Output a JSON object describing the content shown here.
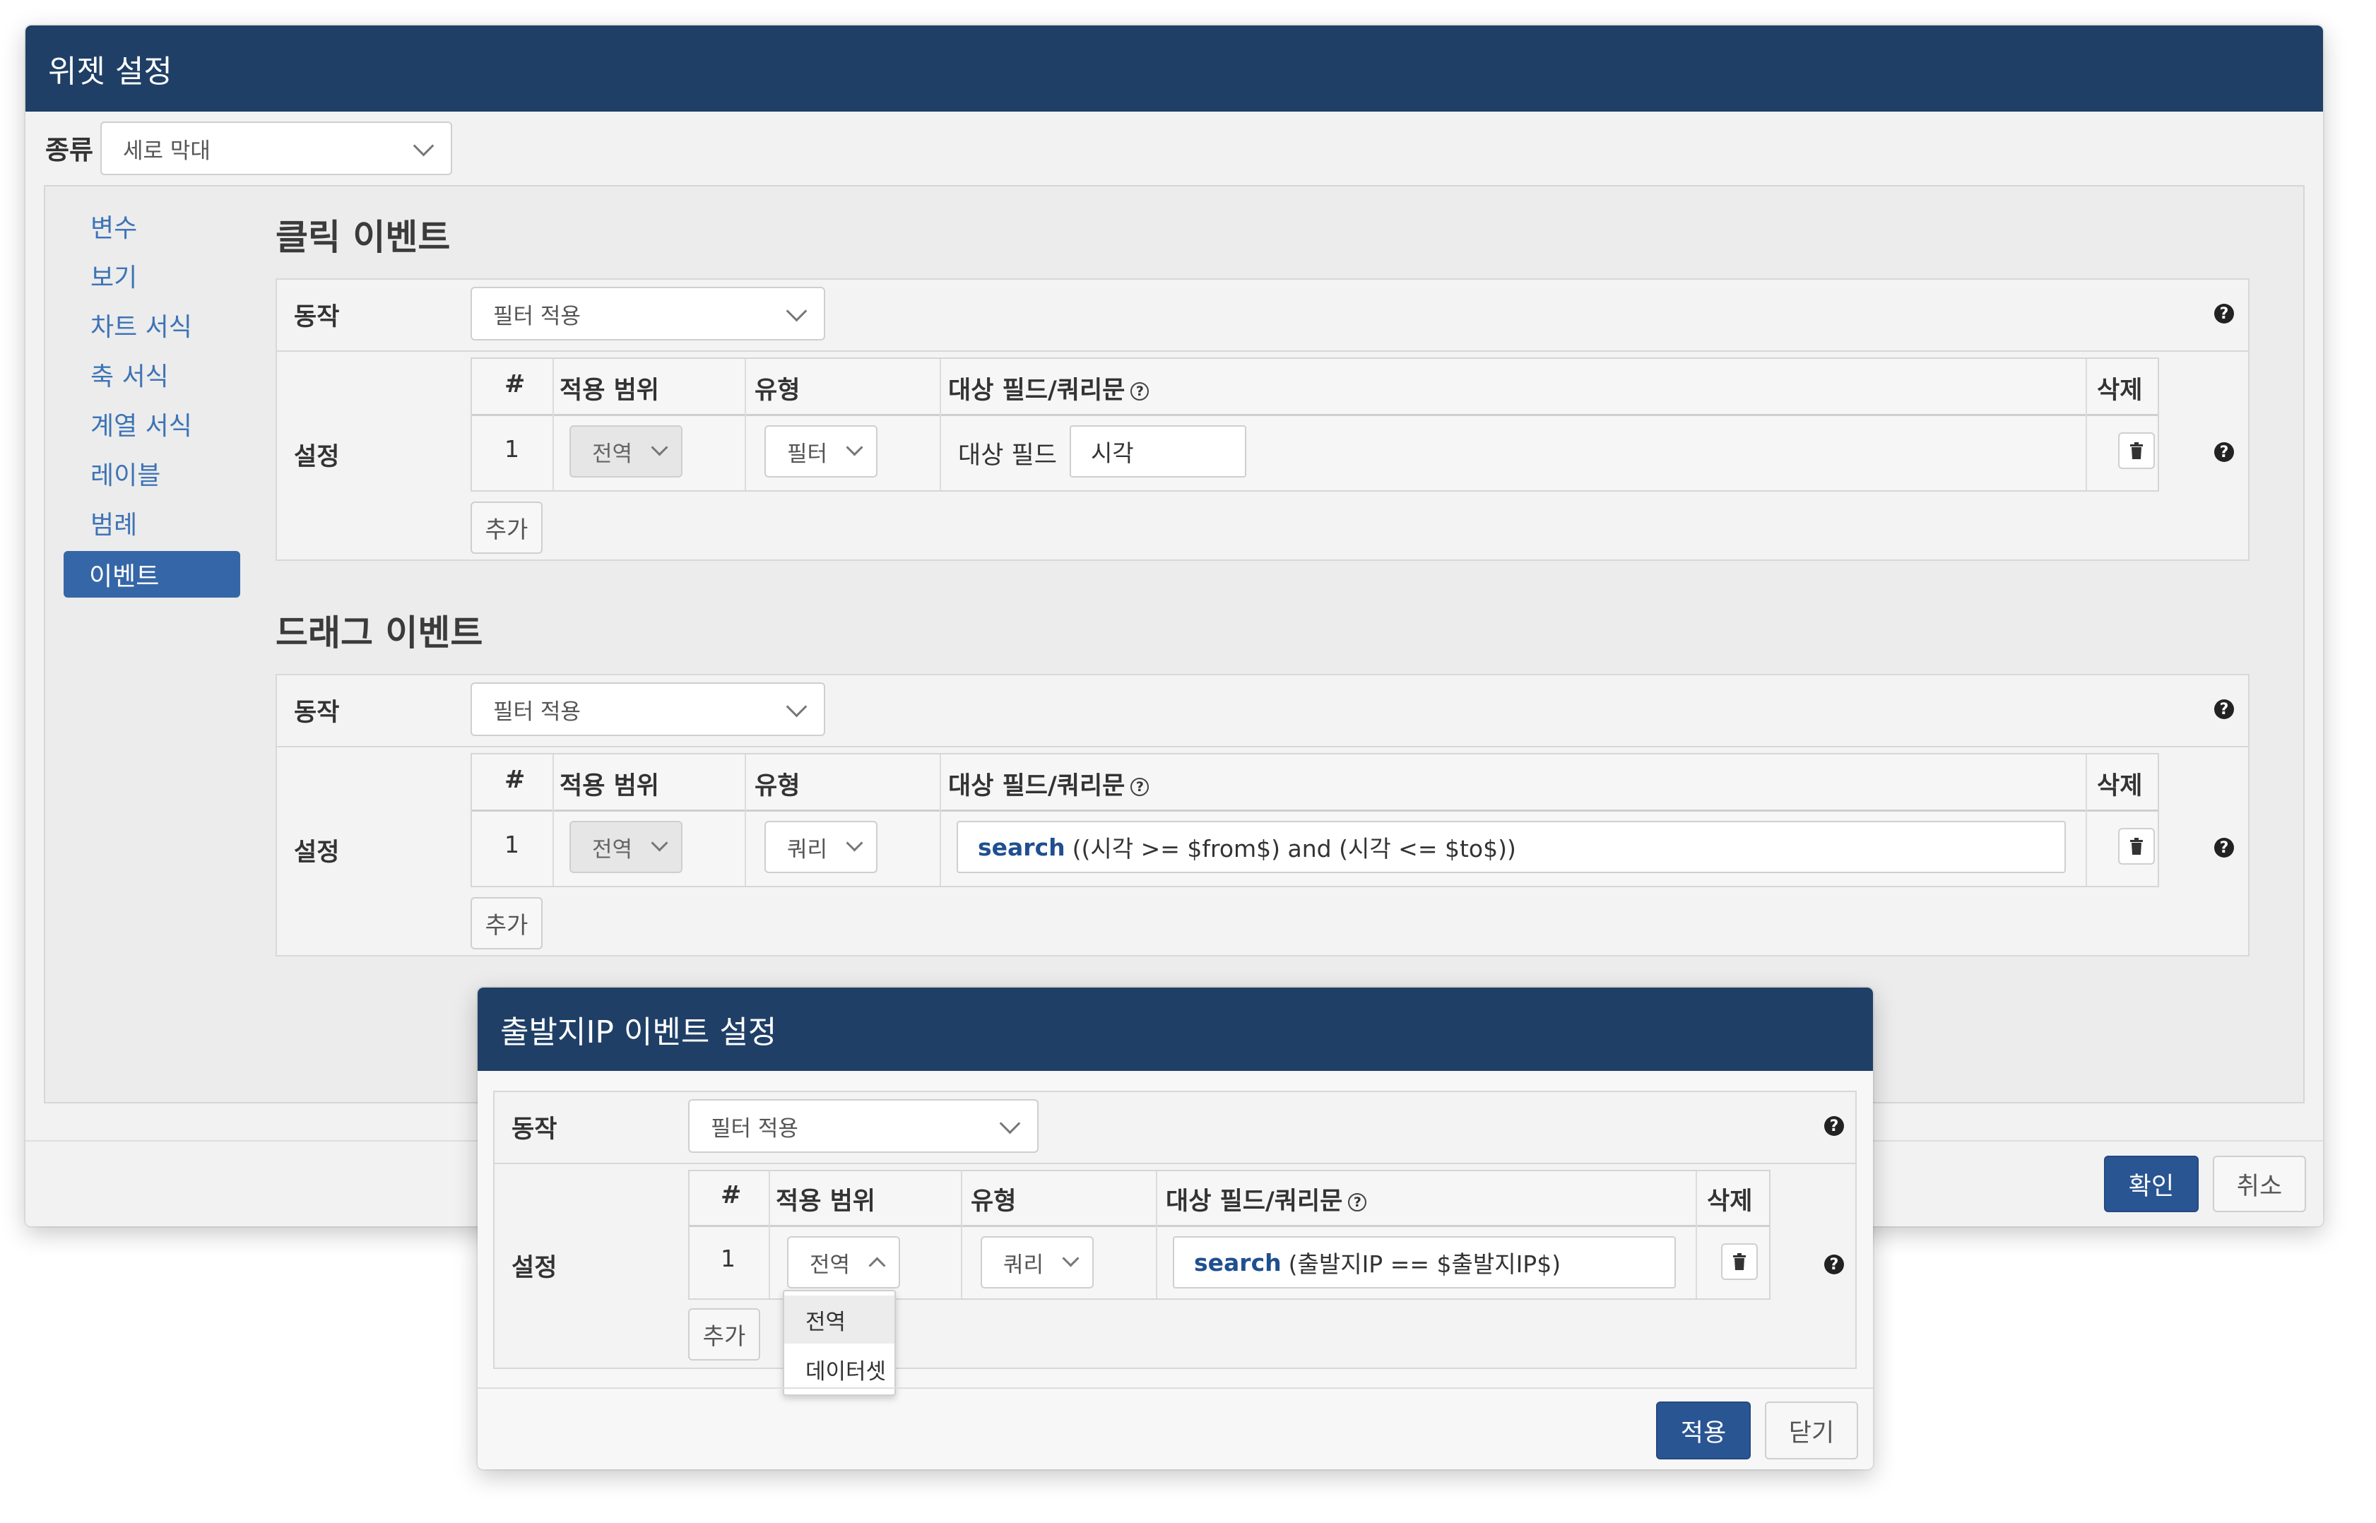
{
  "main_dialog": {
    "title": "위젯 설정",
    "kind_label": "종류",
    "kind_value": "세로 막대",
    "nav": [
      "변수",
      "보기",
      "차트 서식",
      "축 서식",
      "계열 서식",
      "레이블",
      "범례",
      "이벤트"
    ],
    "active_nav": "이벤트",
    "click_event": {
      "title": "클릭 이벤트",
      "action_label": "동작",
      "action_value": "필터 적용",
      "settings_label": "설정",
      "columns": [
        "#",
        "적용 범위",
        "유형",
        "대상 필드/쿼리문",
        "삭제"
      ],
      "row": {
        "num": "1",
        "scope": "전역",
        "type": "필터",
        "target_prefix": "대상 필드",
        "target_value": "시각"
      },
      "add_label": "추가"
    },
    "drag_event": {
      "title": "드래그 이벤트",
      "action_label": "동작",
      "action_value": "필터 적용",
      "settings_label": "설정",
      "columns": [
        "#",
        "적용 범위",
        "유형",
        "대상 필드/쿼리문",
        "삭제"
      ],
      "row": {
        "num": "1",
        "scope": "전역",
        "type": "쿼리",
        "query_keyword": "search",
        "query_rest": "((시각 >= $from$) and (시각 <= $to$))"
      },
      "add_label": "추가"
    },
    "confirm_label": "확인",
    "cancel_label": "취소"
  },
  "sub_dialog": {
    "title": "출발지IP 이벤트 설정",
    "action_label": "동작",
    "action_value": "필터 적용",
    "settings_label": "설정",
    "columns": [
      "#",
      "적용 범위",
      "유형",
      "대상 필드/쿼리문",
      "삭제"
    ],
    "row": {
      "num": "1",
      "scope": "전역",
      "type": "쿼리",
      "query_keyword": "search",
      "query_rest": "(출발지IP == $출발지IP$)"
    },
    "add_label": "추가",
    "dropdown_options": [
      "전역",
      "데이터셋"
    ],
    "apply_label": "적용",
    "close_label": "닫기"
  },
  "colors": {
    "header": "#1f3f66",
    "primary": "#2a5593",
    "link": "#3e74b6"
  },
  "icons": [
    "chevron-down-icon",
    "chevron-up-icon",
    "help-icon",
    "trash-icon",
    "question-circle-icon"
  ]
}
